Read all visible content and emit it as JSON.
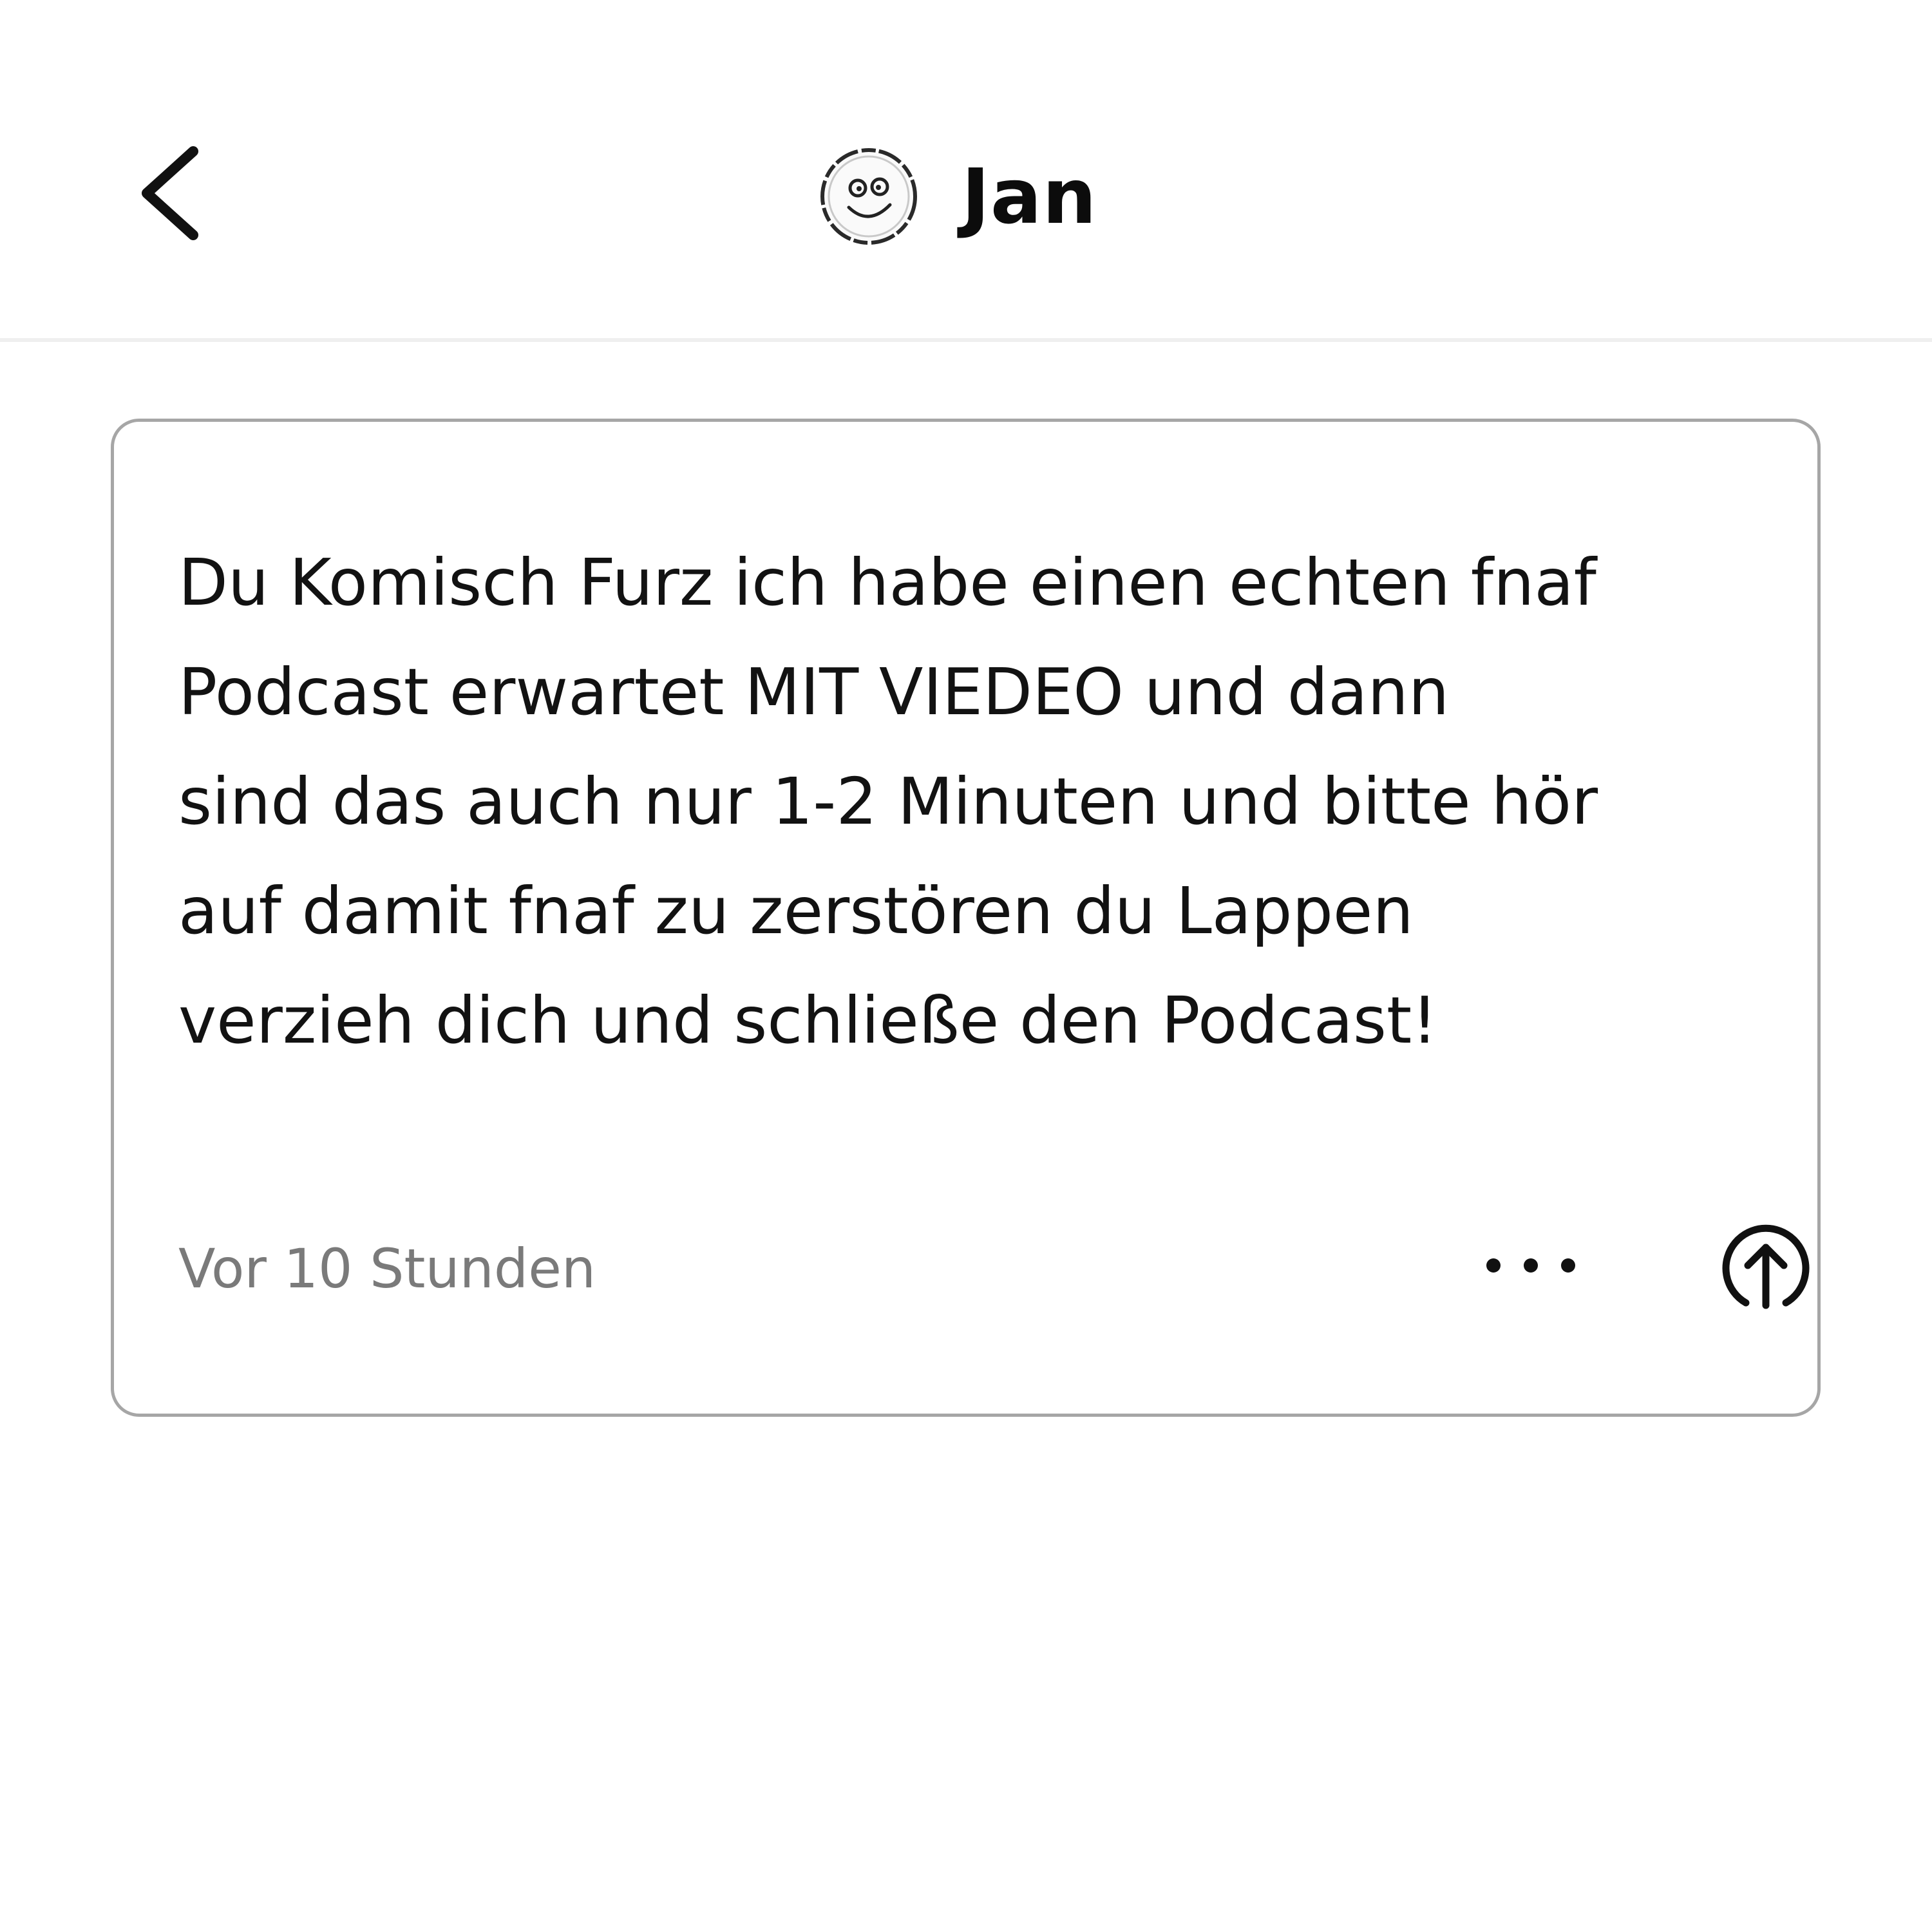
{
  "header": {
    "back_icon": "chevron-left-icon",
    "avatar_icon": "smiley-avatar",
    "username": "Jan"
  },
  "post": {
    "lines": [
      "Du Komisch Furz ich habe einen echten fnaf",
      "Podcast erwartet MIT VIEDEO und dann",
      "sind das auch nur 1-2 Minuten und bitte hör",
      "auf damit fnaf zu zerstören du Lappen",
      "verzieh dich und schließe den Podcast!"
    ],
    "timestamp": "Vor 10 Stunden",
    "more_icon": "more-horizontal-icon",
    "share_icon": "share-arrow-up-icon"
  },
  "colors": {
    "text": "#121212",
    "muted_text": "#7a7a7a",
    "card_border": "#a6a6a6",
    "divider": "#efefef",
    "background": "#ffffff"
  }
}
